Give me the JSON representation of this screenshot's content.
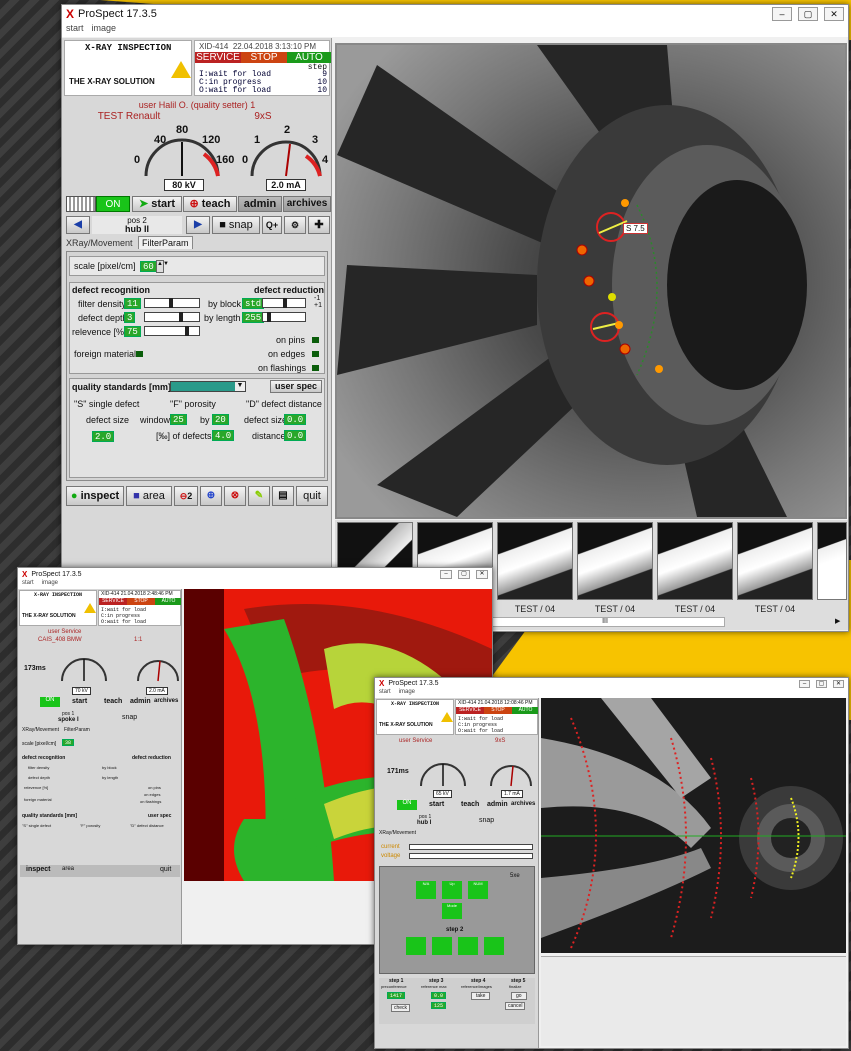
{
  "win1": {
    "title": "ProSpect 17.3.5",
    "menu": [
      "start",
      "image"
    ],
    "header": {
      "left_title": "X-RAY INSPECTION",
      "logo_text": "THE X-RAY SOLUTION",
      "station": "XID-414",
      "datetime": "22.04.2018 3:13:10 PM",
      "status": [
        "SERVICE",
        "STOP",
        "AUTO"
      ],
      "step_label": "step",
      "steps": [
        {
          "text": "I:wait for load",
          "n": "9"
        },
        {
          "text": "C:in progress",
          "n": "10"
        },
        {
          "text": "O:wait for load",
          "n": "10"
        }
      ]
    },
    "user": "user Halil O. (quality setter)",
    "user_num": "1",
    "test_name": "TEST Renault",
    "test_type": "9xS",
    "gauge_kv": {
      "ticks": [
        "40",
        "80",
        "120",
        "0",
        "160"
      ],
      "value": "80 kV"
    },
    "gauge_ma": {
      "ticks": [
        "2",
        "1",
        "3",
        "0",
        "4"
      ],
      "value": "2.0 mA"
    },
    "controls": {
      "on": "ON",
      "start": "start",
      "teach": "teach",
      "admin": "admin",
      "archives": "archives"
    },
    "pos": {
      "label": "pos 2",
      "name": "hub II"
    },
    "snap": "snap",
    "tabs": [
      "XRay/Movement",
      "FilterParam"
    ],
    "scale": {
      "label": "scale [pixel/cm]",
      "value": "60"
    },
    "defect": {
      "recognition": "defect recognition",
      "reduction": "defect reduction",
      "filter_density": "filter density",
      "filter_val": "11",
      "defect_depth": "defect depth",
      "depth_val": "3",
      "relevance": "relevence [%]",
      "relevance_val": "75",
      "foreign": "foreign material",
      "by_block": "by block",
      "block_val": "std",
      "by_length": "by length",
      "length_val": "255",
      "on_pins": "on pins",
      "on_edges": "on edges",
      "on_flashings": "on flashings",
      "pm1": "-1",
      "pm2": "+1"
    },
    "quality": {
      "label": "quality standards [mm]",
      "user_spec": "user spec",
      "s_title": "\"S\" single defect",
      "defect_size": "defect size",
      "s_val": "2.0",
      "f_title": "\"F\" porosity",
      "window": "window",
      "win_val": "25",
      "by": "by",
      "by_val": "20",
      "of_defects": "[‰] of defects",
      "of_val": "4.0",
      "d_title": "\"D\" defect distance",
      "d_size": "defect size",
      "d_size_val": "0.0",
      "distance": "distance",
      "dist_val": "0.0"
    },
    "bottom": {
      "inspect": "inspect",
      "area": "area",
      "z": "2",
      "quit": "quit"
    },
    "defect_tag": "S 7.5",
    "thumb_labels": [
      "TEST / 04",
      "TEST / 04",
      "TEST / 04",
      "TEST / 04"
    ],
    "scroll_mark": "III"
  },
  "win2": {
    "title": "ProSpect 17.3.5",
    "menu": [
      "start",
      "image"
    ],
    "header": {
      "left_title": "X-RAY INSPECTION",
      "logo_text": "THE X-RAY SOLUTION",
      "station": "XID-414",
      "datetime": "21.04.2018 2:48:46 PM",
      "status": [
        "SERVICE",
        "STOP",
        "AUTO"
      ],
      "steps": [
        "I:wait for load",
        "C:in progress",
        "O:wait for load"
      ],
      "nums": [
        "9",
        "10",
        "10"
      ]
    },
    "user": "user Service",
    "test": "CAIS_408 BMW",
    "scale_ratio": "1:1",
    "time": "173ms",
    "kv": "70 kV",
    "ma": "2.0 mA",
    "controls": {
      "on": "ON",
      "start": "start",
      "teach": "teach",
      "admin": "admin",
      "archives": "archives"
    },
    "pos": {
      "label": "pos 1",
      "name": "spoke I"
    },
    "snap": "snap",
    "tabs": [
      "XRay/Movement",
      "FilterParam"
    ],
    "scale_lbl": "scale [pixel/cm]",
    "scale_val": "38",
    "recog": "defect recognition",
    "reduc": "defect reduction",
    "rows": [
      "filter density",
      "defect depth",
      "relevence [%]",
      "foreign material"
    ],
    "rows_r": [
      "by block",
      "by length",
      "on pins",
      "on edges",
      "on flashings"
    ],
    "quality": "quality standards [mm]",
    "user_spec": "user spec",
    "q_titles": [
      "\"S\" single defect",
      "\"F\" porosity",
      "\"D\" defect distance"
    ],
    "bottom": {
      "inspect": "inspect",
      "area": "area",
      "quit": "quit"
    }
  },
  "win3": {
    "title": "ProSpect 17.3.5",
    "menu": [
      "start",
      "image"
    ],
    "header": {
      "left_title": "X-RAY INSPECTION",
      "logo_text": "THE X-RAY SOLUTION",
      "station": "XID-414",
      "datetime": "21.04.2018 12:08:46 PM",
      "status": [
        "SERVICE",
        "STOP",
        "AUTO"
      ],
      "steps": [
        "I:wait for load",
        "C:in progress",
        "O:wait for load"
      ],
      "nums": [
        "9",
        "10",
        "10"
      ]
    },
    "user": "user Service",
    "test": "9xS",
    "time": "171ms",
    "kv": "65 kV",
    "ma": "1.7 mA",
    "controls": {
      "on": "ON",
      "start": "start",
      "teach": "teach",
      "admin": "admin",
      "archives": "archives"
    },
    "pos": {
      "label": "pos 1",
      "name": "hub I"
    },
    "snap": "snap",
    "tab": "XRay/Movement",
    "current": "current",
    "voltage": "voltage",
    "five": "5xe",
    "btn_labels": [
      "N/A",
      "Up",
      "NUM",
      "Mode"
    ],
    "step2": "step 2",
    "steps_bottom": [
      {
        "t": "step 1",
        "s": "preconference"
      },
      {
        "t": "step 3",
        "s": "reference max"
      },
      {
        "t": "step 4",
        "s": "reference/images"
      },
      {
        "t": "step 5",
        "s": "finalize"
      }
    ],
    "check": "check",
    "take": "take",
    "go": "go",
    "cancel": "cancel",
    "val1": "1417",
    "val2": "0.0",
    "val3": "125"
  },
  "colors": {
    "accent_yellow": "#f7c300",
    "status_service": "#b22",
    "status_stop": "#c41",
    "status_auto": "#1a9a1a",
    "green_btn": "#19c419"
  }
}
